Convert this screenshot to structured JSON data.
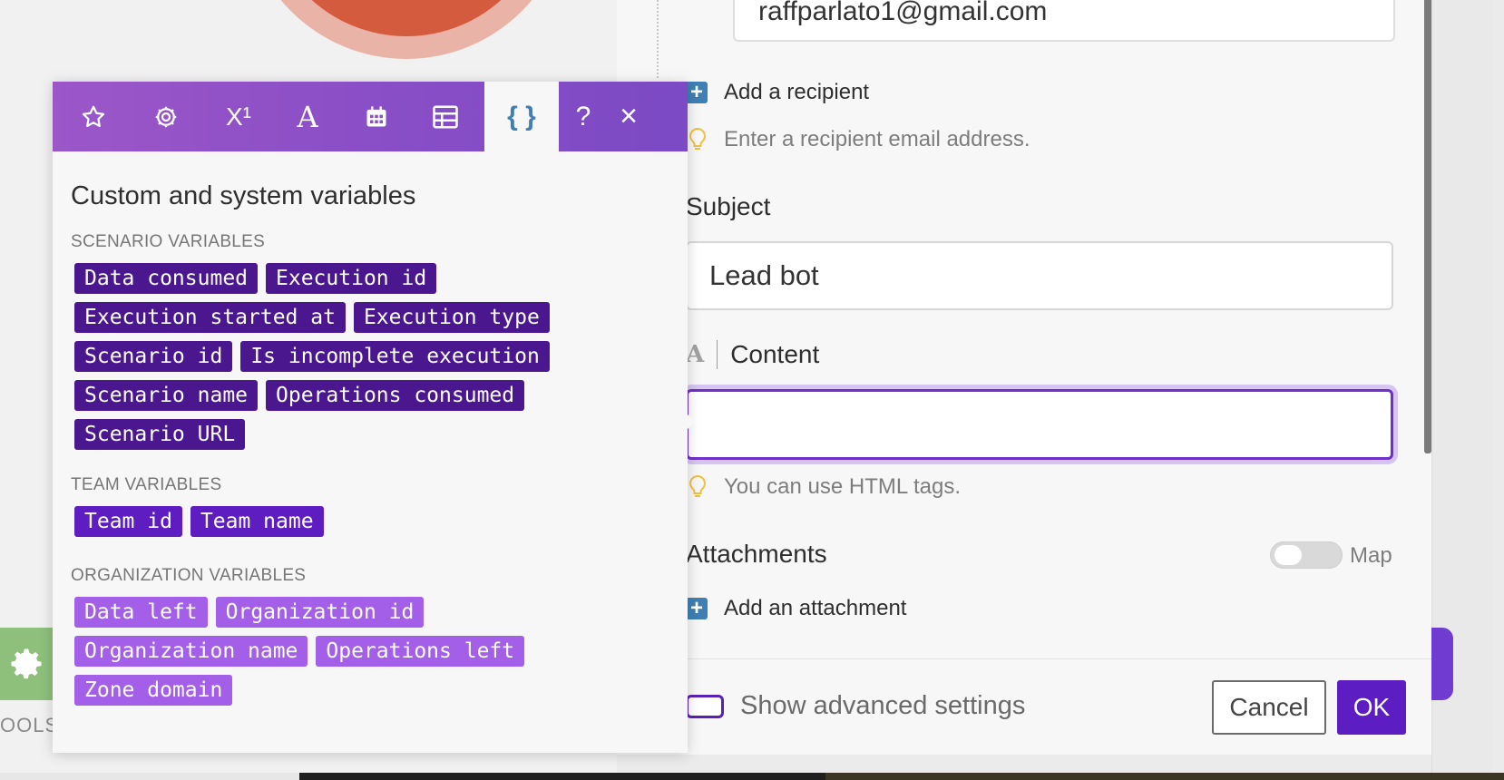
{
  "recipient": {
    "email_value": "raffparlato1@gmail.com",
    "add_label": "Add a recipient",
    "hint": "Enter a recipient email address."
  },
  "subject": {
    "label": "Subject",
    "value": "Lead bot"
  },
  "content": {
    "label": "Content",
    "value": "",
    "hint": "You can use HTML tags."
  },
  "attachments": {
    "label": "Attachments",
    "map_label": "Map",
    "map_enabled": false,
    "add_label": "Add an attachment"
  },
  "footer": {
    "advanced_label": "Show advanced settings",
    "cancel_label": "Cancel",
    "ok_label": "OK"
  },
  "tools_label": "OOLS",
  "popup": {
    "toolbar_icons": [
      "star-icon",
      "gear-icon",
      "superscript-icon",
      "text-icon",
      "calendar-icon",
      "table-icon",
      "braces-icon",
      "help-icon",
      "close-icon"
    ],
    "active_tab": "braces-icon",
    "toolbar_glyphs": {
      "superscript": "X¹",
      "text": "A",
      "braces": "{ }",
      "help": "?",
      "close": "×"
    },
    "title": "Custom and system variables",
    "sections": [
      {
        "label": "SCENARIO VARIABLES",
        "tags": [
          "Data consumed",
          "Execution id",
          "Execution started at",
          "Execution type",
          "Scenario id",
          "Is incomplete execution",
          "Scenario name",
          "Operations consumed",
          "Scenario URL"
        ]
      },
      {
        "label": "TEAM VARIABLES",
        "tags": [
          "Team id",
          "Team name"
        ]
      },
      {
        "label": "ORGANIZATION VARIABLES",
        "tags": [
          "Data left",
          "Organization id",
          "Organization name",
          "Operations left",
          "Zone domain"
        ]
      }
    ]
  },
  "colors": {
    "brand_purple": "#5c1ec2",
    "scenario_tag": "#4b178f",
    "team_tag": "#5e1dc0",
    "organization_tag": "#a35fe8",
    "add_icon_blue": "#3f7fb4",
    "hint_bulb": "#f0c040"
  }
}
